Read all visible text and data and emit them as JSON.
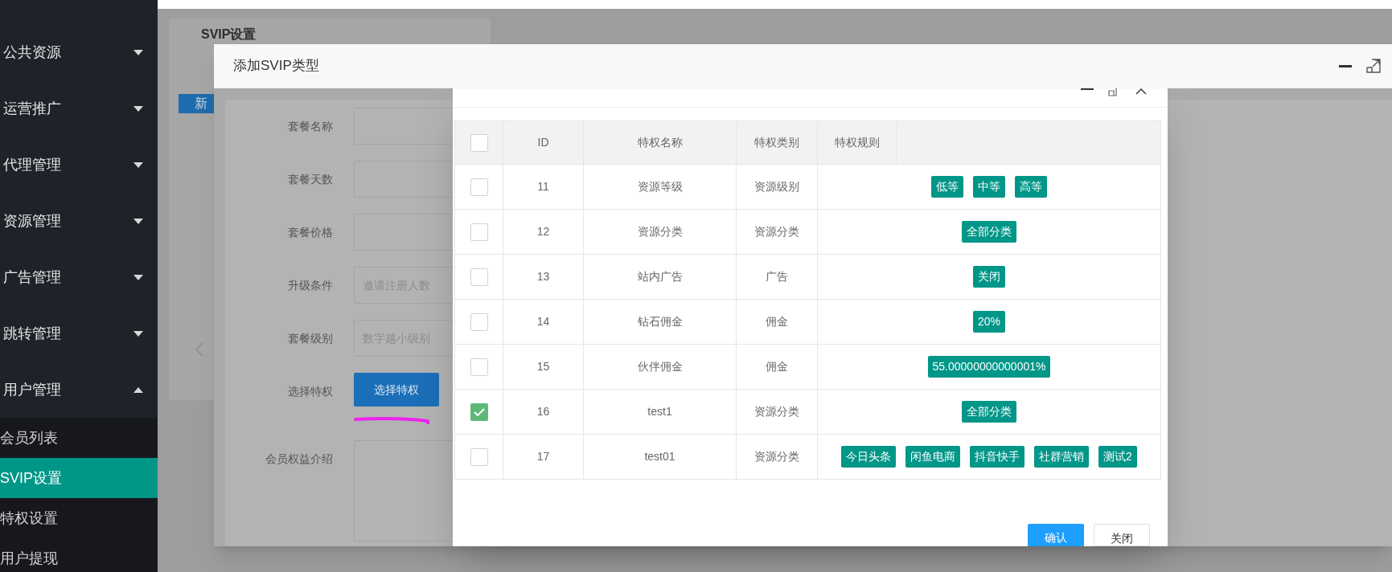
{
  "sidebar": {
    "items": [
      {
        "label": "公共资源",
        "expanded": false
      },
      {
        "label": "运营推广",
        "expanded": false
      },
      {
        "label": "代理管理",
        "expanded": false
      },
      {
        "label": "资源管理",
        "expanded": false
      },
      {
        "label": "广告管理",
        "expanded": false
      },
      {
        "label": "跳转管理",
        "expanded": false
      },
      {
        "label": "用户管理",
        "expanded": true,
        "children": [
          {
            "label": "会员列表",
            "selected": false
          },
          {
            "label": "SVIP设置",
            "selected": true
          },
          {
            "label": "特权设置",
            "selected": false
          },
          {
            "label": "用户提现",
            "selected": false
          }
        ]
      }
    ]
  },
  "page": {
    "tab": "SVIP设置",
    "add_button": "新"
  },
  "outer_dialog": {
    "title": "添加SVIP类型",
    "form": [
      {
        "kind": "input",
        "label": "套餐名称"
      },
      {
        "kind": "input",
        "label": "套餐天数"
      },
      {
        "kind": "input",
        "label": "套餐价格"
      },
      {
        "kind": "input",
        "label": "升级条件",
        "placeholder": "邀请注册人数"
      },
      {
        "kind": "input",
        "label": "套餐级别",
        "placeholder": "数字越小级别"
      },
      {
        "kind": "button",
        "label": "选择特权",
        "button": "选择特权"
      },
      {
        "kind": "textarea",
        "label": "会员权益介绍"
      }
    ]
  },
  "inner_dialog": {
    "table": {
      "header_checked": false,
      "columns": [
        "ID",
        "特权名称",
        "特权类别",
        "特权规则"
      ],
      "rows": [
        {
          "checked": false,
          "id": "11",
          "name": "资源等级",
          "type": "资源级别",
          "rules": [
            "低等",
            "中等",
            "高等"
          ]
        },
        {
          "checked": false,
          "id": "12",
          "name": "资源分类",
          "type": "资源分类",
          "rules": [
            "全部分类"
          ]
        },
        {
          "checked": false,
          "id": "13",
          "name": "站内广告",
          "type": "广告",
          "rules": [
            "关闭"
          ]
        },
        {
          "checked": false,
          "id": "14",
          "name": "钻石佣金",
          "type": "佣金",
          "rules": [
            "20%"
          ]
        },
        {
          "checked": false,
          "id": "15",
          "name": "伙伴佣金",
          "type": "佣金",
          "rules": [
            "55.00000000000001%"
          ]
        },
        {
          "checked": true,
          "id": "16",
          "name": "test1",
          "type": "资源分类",
          "rules": [
            "全部分类"
          ]
        },
        {
          "checked": false,
          "id": "17",
          "name": "test01",
          "type": "资源分类",
          "rules": [
            "今日头条",
            "闲鱼电商",
            "抖音快手",
            "社群营销",
            "测试2"
          ]
        }
      ]
    },
    "buttons": [
      {
        "kind": "primary",
        "label": "确认"
      },
      {
        "kind": "default",
        "label": "关闭"
      }
    ]
  }
}
